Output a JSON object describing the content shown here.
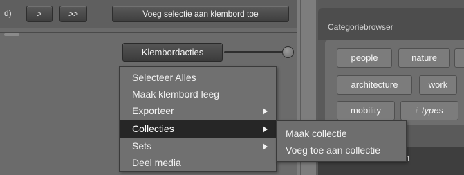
{
  "toolbar": {
    "clip_fragment": "d)",
    "next_label": ">",
    "last_label": ">>",
    "add_to_clipboard_label": "Voeg selectie aan klembord toe"
  },
  "clipboard": {
    "actions_button_label": "Klembordacties"
  },
  "context_menu": {
    "items": [
      {
        "label": "Selecteer Alles",
        "has_submenu": false,
        "selected": false
      },
      {
        "label": "Maak klembord leeg",
        "has_submenu": false,
        "selected": false
      },
      {
        "label": "Exporteer",
        "has_submenu": true,
        "selected": false
      },
      {
        "label": "Collecties",
        "has_submenu": true,
        "selected": true
      },
      {
        "label": "Sets",
        "has_submenu": true,
        "selected": false
      },
      {
        "label": "Deel media",
        "has_submenu": false,
        "selected": false
      }
    ]
  },
  "submenu": {
    "items": [
      {
        "label": "Maak collectie"
      },
      {
        "label": "Voeg toe aan collectie"
      }
    ]
  },
  "category_browser": {
    "title": "Categoriebrowser",
    "tags": [
      {
        "label": "people"
      },
      {
        "label": "nature"
      },
      {
        "label": "architecture"
      },
      {
        "label": "work"
      },
      {
        "label": "mobility"
      },
      {
        "label": "types",
        "info_marker": "i"
      }
    ]
  },
  "right_bottom": {
    "text": "n"
  },
  "colors": {
    "panel_bg": "#6b6b6b",
    "menu_bg": "#707070",
    "menu_selected_bg": "#262626",
    "text": "#f2f2f2"
  }
}
